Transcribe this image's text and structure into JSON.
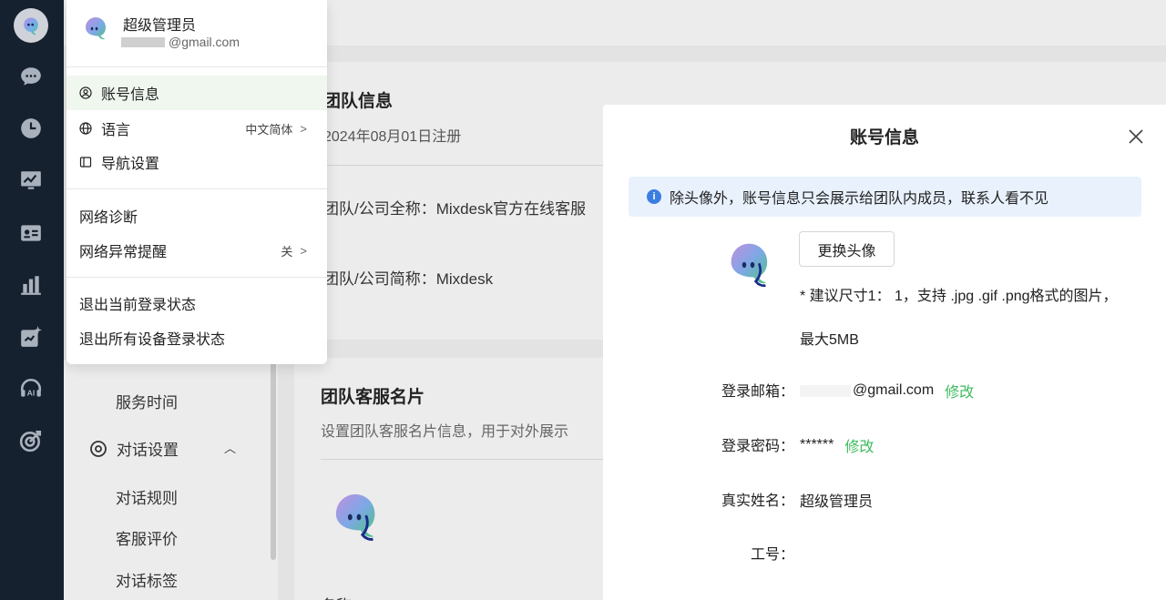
{
  "dropdown": {
    "user_name": "超级管理员",
    "user_email": "@gmail.com",
    "items": [
      {
        "label": "账号信息",
        "icon": "user-circle-icon"
      },
      {
        "label": "语言",
        "icon": "globe-icon",
        "value": "中文简体"
      },
      {
        "label": "导航设置",
        "icon": "sidebar-icon"
      }
    ],
    "network_diagnose": "网络诊断",
    "network_alert": "网络异常提醒",
    "network_alert_value": "关",
    "logout_current": "退出当前登录状态",
    "logout_all": "退出所有设备登录状态"
  },
  "team_info": {
    "title": "团队信息",
    "registered": "2024年08月01日注册",
    "full_name": "团队/公司全称：Mixdesk官方在线客服",
    "short_name": "团队/公司简称：Mixdesk"
  },
  "team_card": {
    "title": "团队客服名片",
    "subtitle": "设置团队客服名片信息，用于对外展示",
    "name": "名称：Mixdesk"
  },
  "sidebar": {
    "service_time": "服务时间",
    "chat_settings": "对话设置",
    "chat_rules": "对话规则",
    "rating": "客服评价",
    "tags": "对话标签"
  },
  "modal": {
    "title": "账号信息",
    "notice": "除头像外，账号信息只会展示给团队内成员，联系人看不见",
    "change_avatar": "更换头像",
    "hint_line1": "* 建议尺寸1： 1，支持 .jpg .gif .png格式的图片，",
    "hint_line2": "最大5MB",
    "email_label": "登录邮箱：",
    "email_value": "@gmail.com",
    "password_label": "登录密码：",
    "password_value": "******",
    "modify": "修改",
    "realname_label": "真实姓名：",
    "realname_value": "超级管理员",
    "jobno_label": "工号："
  },
  "colors": {
    "rail": "#16212f",
    "accent_green": "#3dbb5e",
    "info_blue": "#3a7ee0"
  }
}
